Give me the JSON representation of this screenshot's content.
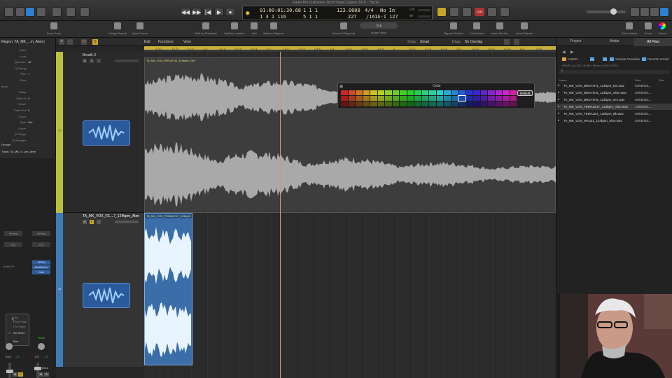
{
  "window": {
    "title": "Fader Pro O.Romero Tech House Course 2016 - Tracks"
  },
  "transport": {
    "position_time": "01:00:01:30.68",
    "position_beats": "1 3 1 116",
    "beats_top": "1 1 1",
    "beats_bottom": "5 1 1",
    "beats_top_sub": "1",
    "beats_bottom_sub": "1",
    "tempo": "123.0000",
    "tempo_sub": "227",
    "signature": "4/4",
    "division": "/16",
    "in_label": "No In",
    "out_label": "1A-1 127",
    "cpu_label": "CPU",
    "hd_label": "HD",
    "counter_box": "1234"
  },
  "toolbar": {
    "items": [
      "Snap Zoom",
      "Nudge Repeat",
      "Spot Freeze",
      "Split by Playhead",
      "Split by Locators",
      "Join",
      "Bounce Regions",
      "Move to Playhead",
      "Nudge Value",
      "Repeat Section",
      "Cut Section",
      "Insert Section",
      "Insert Silence",
      "Set Locators",
      "Zoom",
      "Colors"
    ],
    "nudge_value": "Tick"
  },
  "inspector": {
    "region_label": "Region: TA_MK_...m_Abm.t",
    "rows": [
      {
        "label": "Mute:",
        "value": ""
      },
      {
        "label": "Loop:",
        "value": ""
      },
      {
        "label": "Quantize:",
        "value": "off"
      },
      {
        "label": "Q-Swing:",
        "value": ""
      },
      {
        "label": "Flex:",
        "value": "✓"
      },
      {
        "label": "Gain:",
        "value": ""
      },
      {
        "label": "More",
        "value": ""
      },
      {
        "label": "Delay:",
        "value": ""
      },
      {
        "label": "Fade In:",
        "value": "0"
      },
      {
        "label": "Curve:",
        "value": ""
      },
      {
        "label": "Fade Out:",
        "value": "0"
      },
      {
        "label": "Curve:",
        "value": ""
      },
      {
        "label": "Type:",
        "value": "Out"
      },
      {
        "label": "Curve:",
        "value": ""
      },
      {
        "label": "Q-Range:",
        "value": ""
      },
      {
        "label": "Q-Strength:",
        "value": ""
      }
    ],
    "groups_label": "Groups",
    "track_label": "Track: TA_MK_V...pm_Abm",
    "setting1": "Setting",
    "setting2": "Setting",
    "eq1": "EQ",
    "eq2": "EQ",
    "audio_fx": "Audio FX",
    "span": "SPAN",
    "multimeter": "MultiMeter",
    "gain_plugin": "Gain",
    "send_menu": [
      "Pan",
      "Post Fader",
      "Pre Fader",
      "No Send",
      "Bus"
    ],
    "read1": "Read",
    "vol1": "23.0",
    "vol1b": "-27",
    "vol2": "0.0",
    "vol2b": "-27",
    "bnce": "Bnce",
    "m_label": "M",
    "s_label": "S",
    "i_label": "I",
    "r_label": "R"
  },
  "tracks_header": {
    "edit": "Edit",
    "functions": "Functions",
    "view": "View",
    "snap_label": "Snap:",
    "snap_value": "Smart",
    "drag_label": "Drag:",
    "drag_value": "No Overlap"
  },
  "ruler": {
    "ticks": [
      "1.1.2",
      "1.1.3",
      "1.1.4",
      "1.2",
      "1.2.2",
      "1.2.3",
      "1.2.4",
      "1.3",
      "1.3.2",
      "1.3.3",
      "1.3.4",
      "1.4",
      "1.4.2",
      "1.4.3",
      "1.4.4",
      "2",
      "2.1.2",
      "2.1.3",
      "2.1.4",
      "2.2",
      "2.2.2",
      "2.2.3",
      "2.2.4",
      "2.3",
      "2.3.2"
    ]
  },
  "tracks": [
    {
      "number": "37",
      "name": "Breath 3",
      "region_name": "TA_MK_VOX_BREATH3_124bpm_Gm",
      "color": "#b9c13a",
      "region_color": "#3a3a3a"
    },
    {
      "number": "38",
      "name": "TA_MK_VOX_FE....7_124bpm_Abm",
      "region_name": "TA_MK_VOX_FEMALE17_124bpm",
      "color": "#3f7ab8",
      "region_color": "#3b6ea8"
    }
  ],
  "color_palette": {
    "title": "Color",
    "default_button": "Default"
  },
  "browser": {
    "tabs": [
      "Project",
      "Media",
      "All Files"
    ],
    "path": [
      "AUDIO",
      "Sample Favorites",
      "Favorite Vocals"
    ],
    "file_info": "WAVE | 44,100 | 24 Bit | Stereo | 0:00:13.033",
    "columns": [
      "Name",
      "Date",
      "Size"
    ],
    "files": [
      {
        "name": "TA_MK_VOX_BREATH1_124bpm_Em.wav",
        "date": "03/08/201..."
      },
      {
        "name": "TA_MK_VOX_BREATH2_124bpm_Gbm.wav",
        "date": "03/08/201..."
      },
      {
        "name": "TA_MK_VOX_BREATH3_124bpm_Gm.wav",
        "date": "03/08/201..."
      },
      {
        "name": "TA_MK_VOX_FEMALE17_124bpm_Abm.wav",
        "date": "14/09/201..."
      },
      {
        "name": "TA_MK_VOX_FEMALE4_126bpm_Bb.wav",
        "date": "03/08/201..."
      },
      {
        "name": "TA_MK_VOX_MALE1_124bpm_Abm.wav",
        "date": "03/08/201..."
      }
    ]
  },
  "colors": {
    "cycle": "#c9b23a",
    "playhead": "#c9a64b",
    "track1": "#b9c13a",
    "track2": "#3f7ab8",
    "region_selected": "#3b6ea8"
  }
}
